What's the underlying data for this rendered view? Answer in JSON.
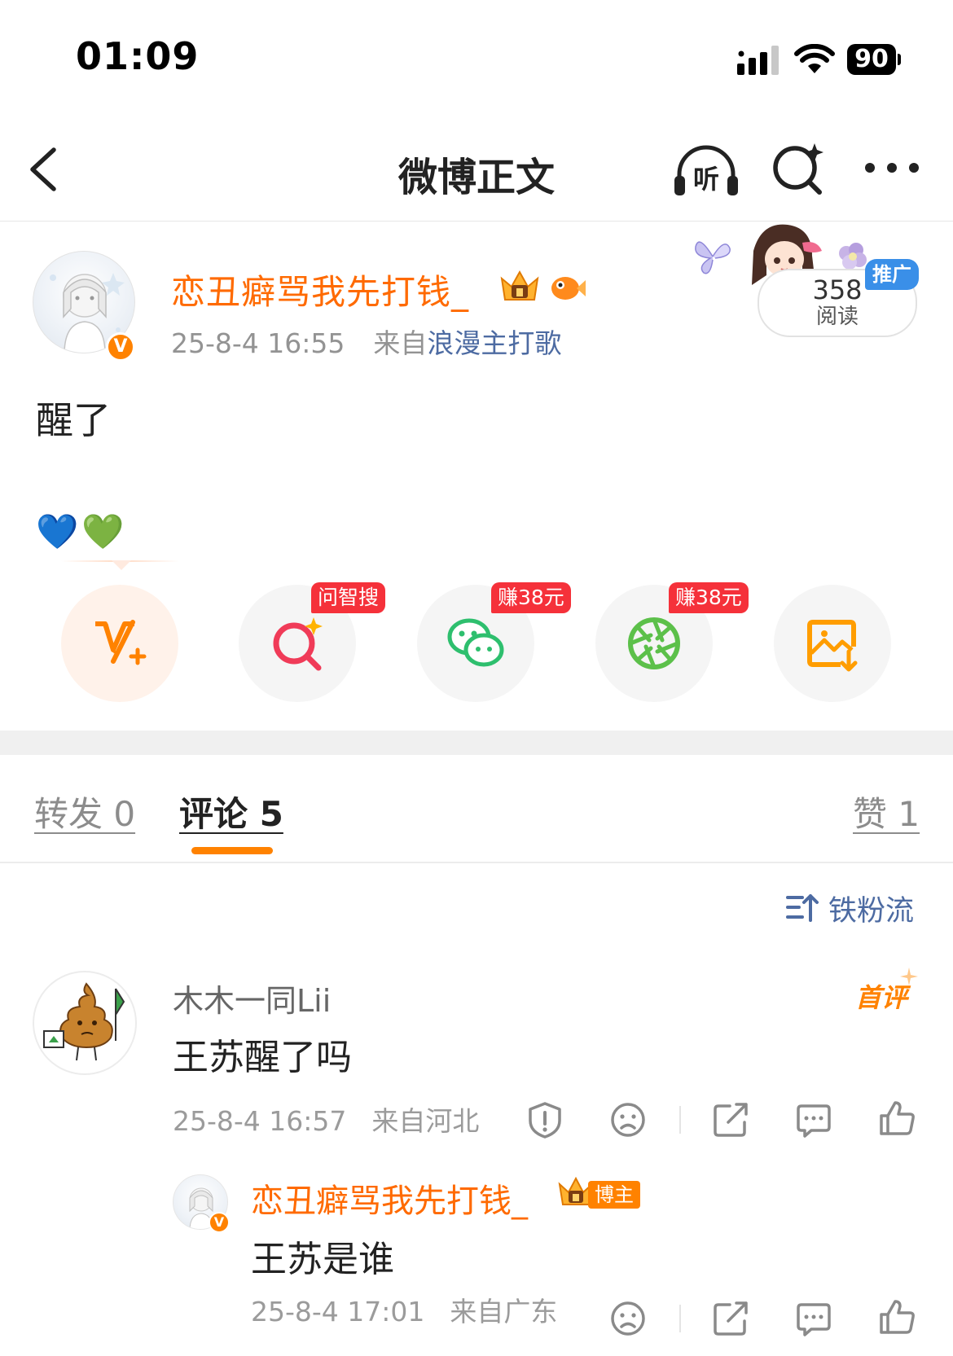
{
  "status_bar": {
    "time": "01:09",
    "battery": "90"
  },
  "nav": {
    "title": "微博正文",
    "listen_icon_text": "听"
  },
  "post": {
    "author": "恋丑癖骂我先打钱_",
    "verified_mark": "V",
    "time": "25-8-4 16:55",
    "source_prefix": "来自",
    "source": "浪漫主打歌",
    "read_count": "358",
    "read_label": "阅读",
    "promo_tag": "推广",
    "text": "醒了",
    "emoji": [
      "💙",
      "💚"
    ]
  },
  "share": {
    "search_tag": "问智搜",
    "wechat_tag": "赚38元",
    "moments_tag": "赚38元"
  },
  "tabs": {
    "repost": "转发 0",
    "comments": "评论 5",
    "likes": "赞 1"
  },
  "sort": {
    "label": "铁粉流"
  },
  "comments": [
    {
      "name": "木木一同Lii",
      "badge": "首评",
      "text": "王苏醒了吗",
      "time": "25-8-4 16:57",
      "location": "来自河北"
    }
  ],
  "reply": {
    "name": "恋丑癖骂我先打钱_",
    "verified_mark": "V",
    "tag": "博主",
    "text": "王苏是谁",
    "time": "25-8-4 17:01",
    "location": "来自广东"
  },
  "colors": {
    "brand_orange": "#ff8200",
    "link_blue": "#4d6ba2",
    "tag_red": "#f5313a",
    "promo_blue": "#3a8fe8"
  }
}
